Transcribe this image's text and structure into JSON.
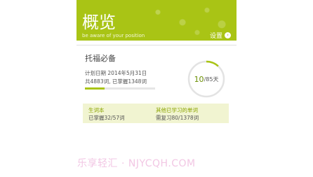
{
  "header": {
    "title": "概览",
    "subtitle": "be aware of your position",
    "settings_label": "设置"
  },
  "plan": {
    "name": "托福必备",
    "plan_date": "计划日期 2014年5月31日",
    "word_count": "共4883词, 已掌握1348词",
    "progress_fraction": 0.276,
    "days_done": "10",
    "days_total": "/85天",
    "days_fraction": 0.118,
    "accent_color": "#a9c415"
  },
  "stats": {
    "left_key": "生词本",
    "left_value": "已掌握32/57词",
    "right_key": "其他已学习的单词",
    "right_value": "需复习80/1378词"
  },
  "watermark": "乐享轻汇 · NJYCQH.COM"
}
